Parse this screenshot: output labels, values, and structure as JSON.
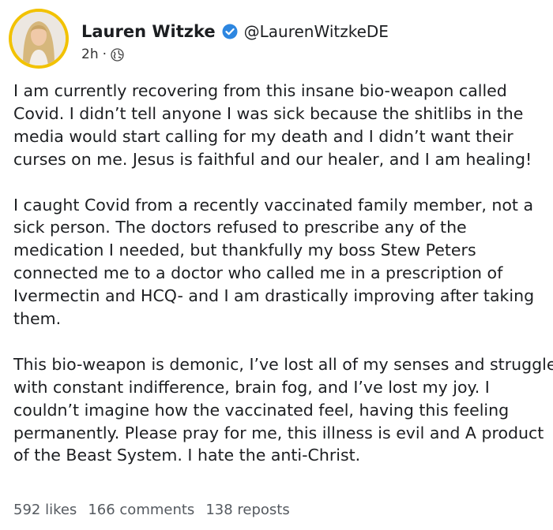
{
  "author": {
    "name": "Lauren Witzke",
    "handle": "@LaurenWitzkeDE",
    "verified": true,
    "avatar_ring_color": "#f2c200"
  },
  "post": {
    "timestamp": "2h",
    "separator": "·",
    "visibility_icon": "globe-icon",
    "paragraphs": [
      [
        "I am currently recovering from this insane bio-weapon called",
        "Covid. I didn’t tell anyone I was sick because the shitlibs in the",
        "media would start calling for my death and I didn’t want their",
        "curses on me. Jesus is faithful and our healer, and I am healing!"
      ],
      [
        "I caught Covid from a recently vaccinated family member, not a",
        "sick person. The doctors refused to prescribe any of the",
        "medication I needed, but thankfully my boss Stew Peters",
        "connected me to a doctor who called me in a prescription of",
        "Ivermectin and HCQ- and I am drastically improving after taking",
        "them."
      ],
      [
        "This bio-weapon is demonic, I’ve lost all of my senses and struggle",
        "with constant indifference, brain fog, and I’ve lost my joy. I",
        "couldn’t imagine how the vaccinated feel, having this feeling",
        "permanently. Please pray for me, this illness is evil and A product",
        "of the Beast System. I hate the anti-Christ."
      ]
    ]
  },
  "stats": {
    "likes": "592 likes",
    "comments": "166 comments",
    "reposts": "138 reposts"
  },
  "colors": {
    "verified_blue": "#2d86e0",
    "text": "#1c1e21",
    "muted": "#555a60"
  }
}
